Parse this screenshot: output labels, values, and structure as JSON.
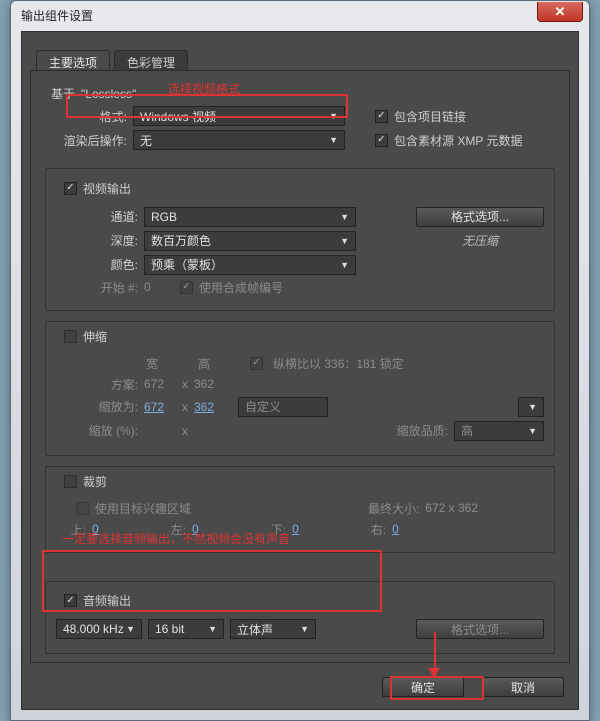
{
  "window": {
    "title": "输出组件设置"
  },
  "tabs": {
    "main": "主要选项",
    "color": "色彩管理"
  },
  "annot": {
    "basedOn": "选择视频格式",
    "audio": "一定要选择音频输出，不然视频会没有声音"
  },
  "basedOn": {
    "prefix": "基于",
    "name": "Lossless"
  },
  "format": {
    "label": "格式:",
    "value": "Windows 视频",
    "link_label": "包含项目链接"
  },
  "postRender": {
    "label": "渲染后操作:",
    "value": "无",
    "xmp_label": "包含素材源 XMP 元数据"
  },
  "video": {
    "legend": "视频输出",
    "channel_label": "通道:",
    "channel_value": "RGB",
    "depth_label": "深度:",
    "depth_value": "数百万颜色",
    "color_label": "颜色:",
    "color_value": "预乘（蒙板）",
    "start_label": "开始 #:",
    "start_value": "0",
    "use_comp": "使用合成帧编号",
    "opts_btn": "格式选项...",
    "compress": "无压缩"
  },
  "stretch": {
    "legend": "伸缩",
    "w_h": "宽",
    "h_h": "高",
    "lock": "纵横比以 336：181 锁定",
    "scheme_label": "方案:",
    "scheme_w": "672",
    "scheme_h": "362",
    "to_label": "缩放为:",
    "to_w": "672",
    "to_h": "362",
    "to_preset": "自定义",
    "pct_label": "缩放 (%):",
    "x": "x",
    "q_label": "缩放品质:",
    "q_value": "高"
  },
  "crop": {
    "legend": "裁剪",
    "roi": "使用目标兴趣区域",
    "final": "最终大小:",
    "final_val": "672 x 362",
    "t": "上:",
    "l": "左:",
    "b": "下:",
    "r": "右:",
    "zero": "0"
  },
  "audio": {
    "legend": "音频输出",
    "rate": "48.000 kHz",
    "bits": "16 bit",
    "chan": "立体声",
    "opts_btn": "格式选项..."
  },
  "footer": {
    "ok": "确定",
    "cancel": "取消"
  }
}
